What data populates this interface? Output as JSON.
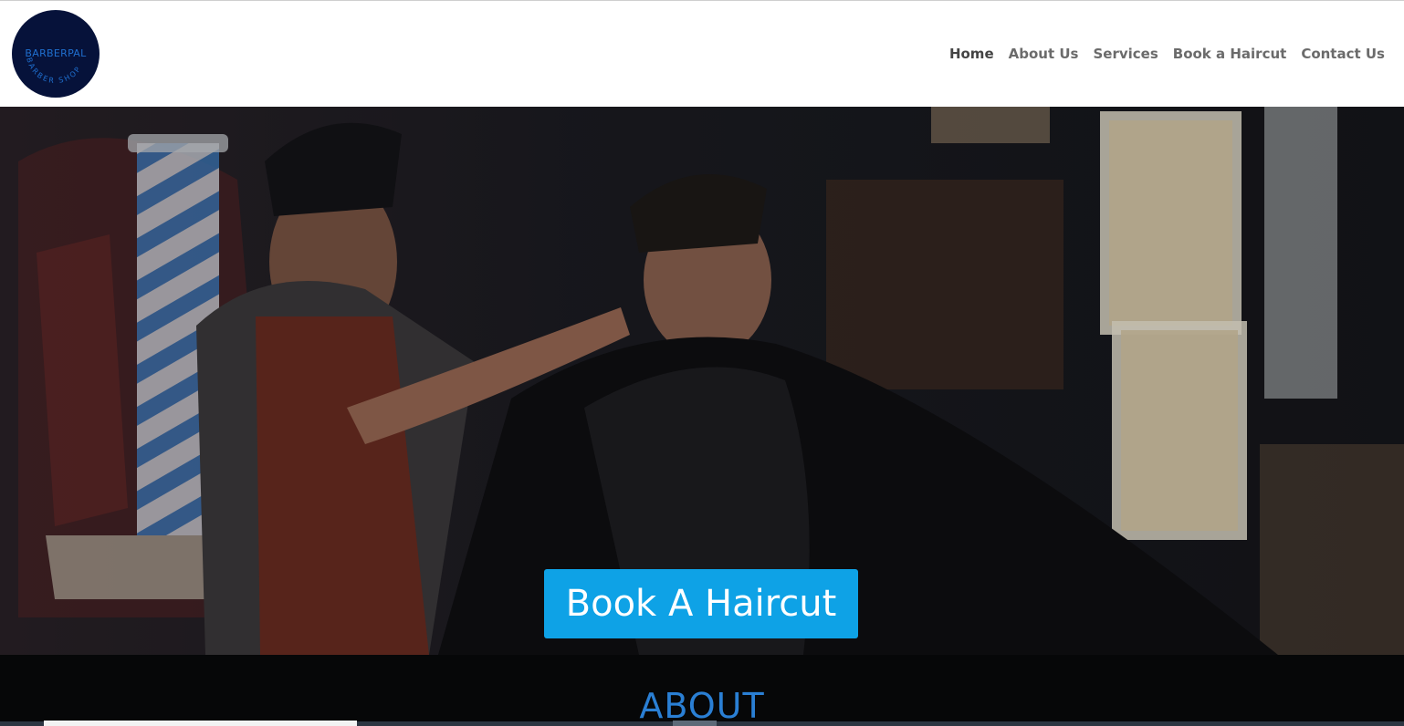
{
  "logo": {
    "name": "BARBERPAL",
    "ring_text": "BARBER SHOP"
  },
  "nav": {
    "items": [
      {
        "label": "Home",
        "active": true
      },
      {
        "label": "About Us",
        "active": false
      },
      {
        "label": "Services",
        "active": false
      },
      {
        "label": "Book a Haircut",
        "active": false
      },
      {
        "label": "Contact Us",
        "active": false
      }
    ]
  },
  "hero": {
    "image": "barber-cutting-hair-photo",
    "cta_label": "Book A Haircut"
  },
  "about": {
    "title": "ABOUT"
  },
  "colors": {
    "accent": "#0ea2e6",
    "heading_blue": "#2a7fd4",
    "logo_bg": "#06123a",
    "nav_text": "#6b6b6b"
  }
}
